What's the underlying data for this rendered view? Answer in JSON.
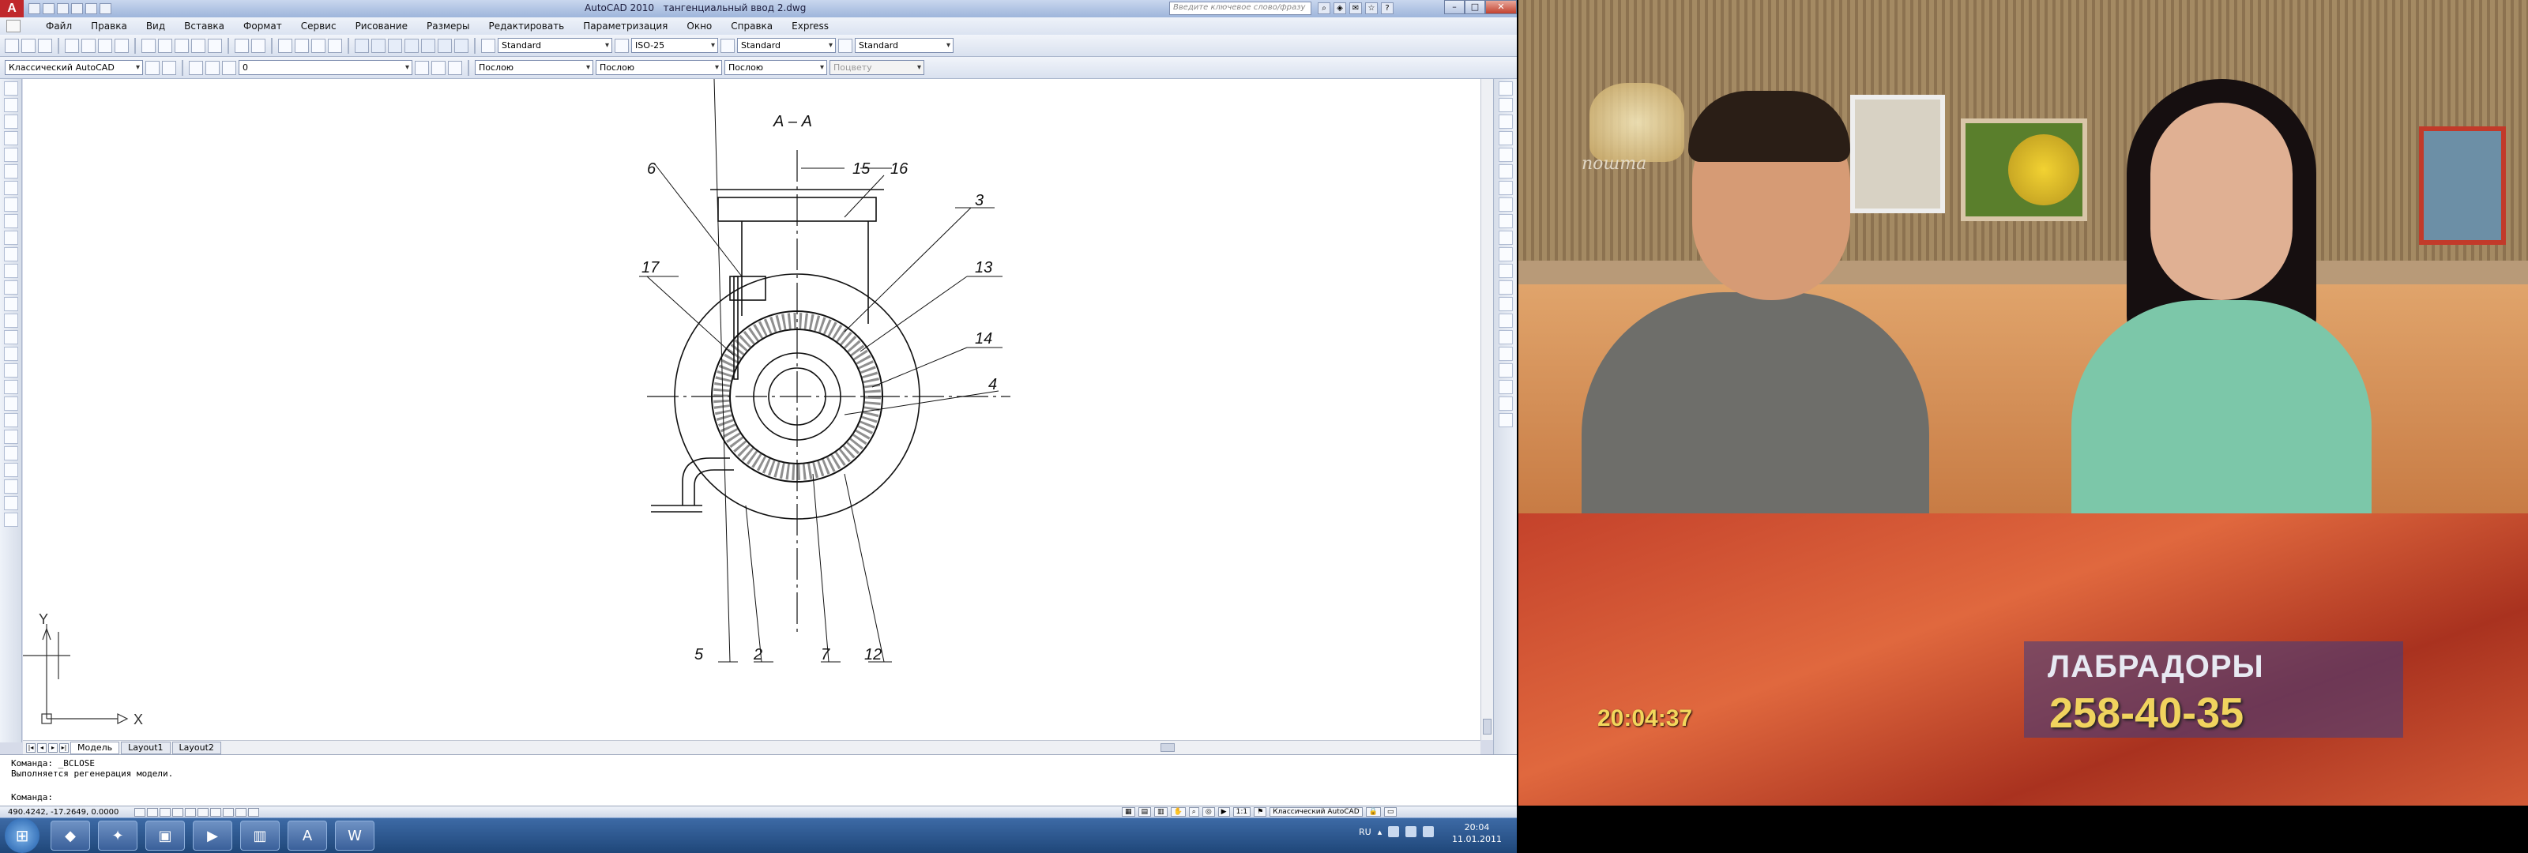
{
  "titlebar": {
    "app_title": "AutoCAD 2010",
    "file_title": "тангенциальный ввод 2.dwg",
    "search_placeholder": "Введите ключевое слово/фразу"
  },
  "menu": {
    "items": [
      "Файл",
      "Правка",
      "Вид",
      "Вставка",
      "Формат",
      "Сервис",
      "Рисование",
      "Размеры",
      "Редактировать",
      "Параметризация",
      "Окно",
      "Справка",
      "Express"
    ]
  },
  "toolbar": {
    "text_style": "Standard",
    "dim_style": "ISO-25",
    "table_style": "Standard",
    "multileader_style": "Standard",
    "workspace": "Классический AutoCAD",
    "layer": "0",
    "color": "Послою",
    "linetype": "Послою",
    "lineweight": "Послою",
    "plotstyle": "Поцвету"
  },
  "drawing": {
    "section_label": "А – А",
    "callouts": [
      "6",
      "15",
      "16",
      "3",
      "17",
      "13",
      "14",
      "4",
      "5",
      "2",
      "7",
      "12"
    ]
  },
  "ucs": {
    "y_label": "Y",
    "x_label": "X"
  },
  "layout_tabs": [
    "Модель",
    "Layout1",
    "Layout2"
  ],
  "command": {
    "history": [
      "Команда: _BCLOSE",
      "Выполняется регенерация модели."
    ],
    "prompt": "Команда:"
  },
  "status": {
    "coords": "490.4242, -17.2649, 0.0000",
    "annotation_scale": "1:1",
    "workspace": "Классический AutoCAD"
  },
  "video": {
    "channel_logo": "пошта",
    "timecode": "20:04:37",
    "banner_title": "ЛАБРАДОРЫ",
    "banner_phone": "258-40-35"
  },
  "tray": {
    "lang": "RU",
    "time": "20:04",
    "date": "11.01.2011"
  },
  "colors": {
    "autocad_brand": "#c0282c",
    "banner_phone": "#f0d35e",
    "timecode": "#f2d65c"
  }
}
